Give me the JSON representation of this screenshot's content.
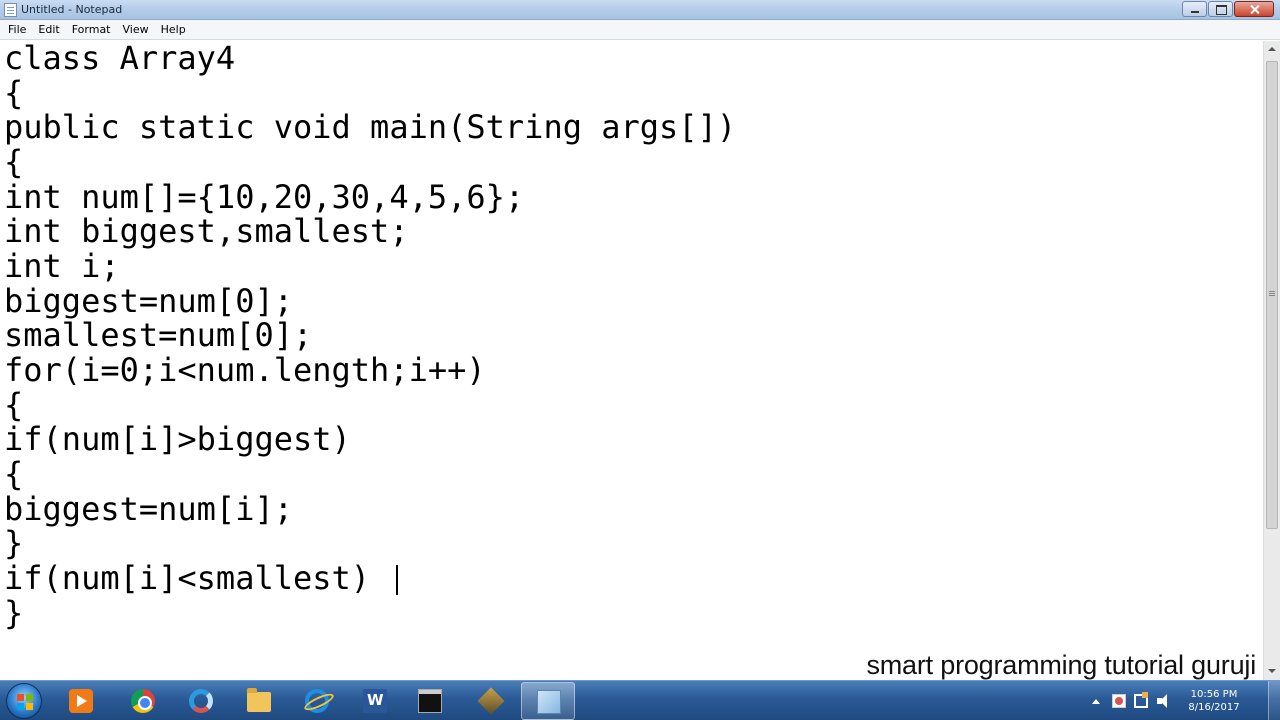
{
  "window": {
    "title": "Untitled - Notepad",
    "icon": "notepad-icon"
  },
  "menu": [
    "File",
    "Edit",
    "Format",
    "View",
    "Help"
  ],
  "editor": {
    "lines": [
      "class Array4",
      "{",
      "public static void main(String args[])",
      "{",
      "int num[]={10,20,30,4,5,6};",
      "int biggest,smallest;",
      "int i;",
      "biggest=num[0];",
      "smallest=num[0];",
      "for(i=0;i<num.length;i++)",
      "{",
      "if(num[i]>biggest)",
      "{",
      "biggest=num[i];",
      "}",
      "if(num[i]<smallest)",
      "}"
    ]
  },
  "watermark": "smart programming tutorial guruji",
  "taskbar": {
    "items": [
      {
        "icon": "media-player-icon",
        "active": false
      },
      {
        "icon": "chrome-icon",
        "active": false
      },
      {
        "icon": "swirl-app-icon",
        "active": false
      },
      {
        "icon": "folder-icon",
        "active": false
      },
      {
        "icon": "internet-explorer-icon",
        "active": false
      },
      {
        "icon": "word-icon",
        "active": false
      },
      {
        "icon": "command-prompt-icon",
        "active": false
      },
      {
        "icon": "tool-icon",
        "active": false
      },
      {
        "icon": "notepad-icon",
        "active": true
      }
    ],
    "clock": {
      "time": "10:56 PM",
      "date": "8/16/2017"
    }
  }
}
